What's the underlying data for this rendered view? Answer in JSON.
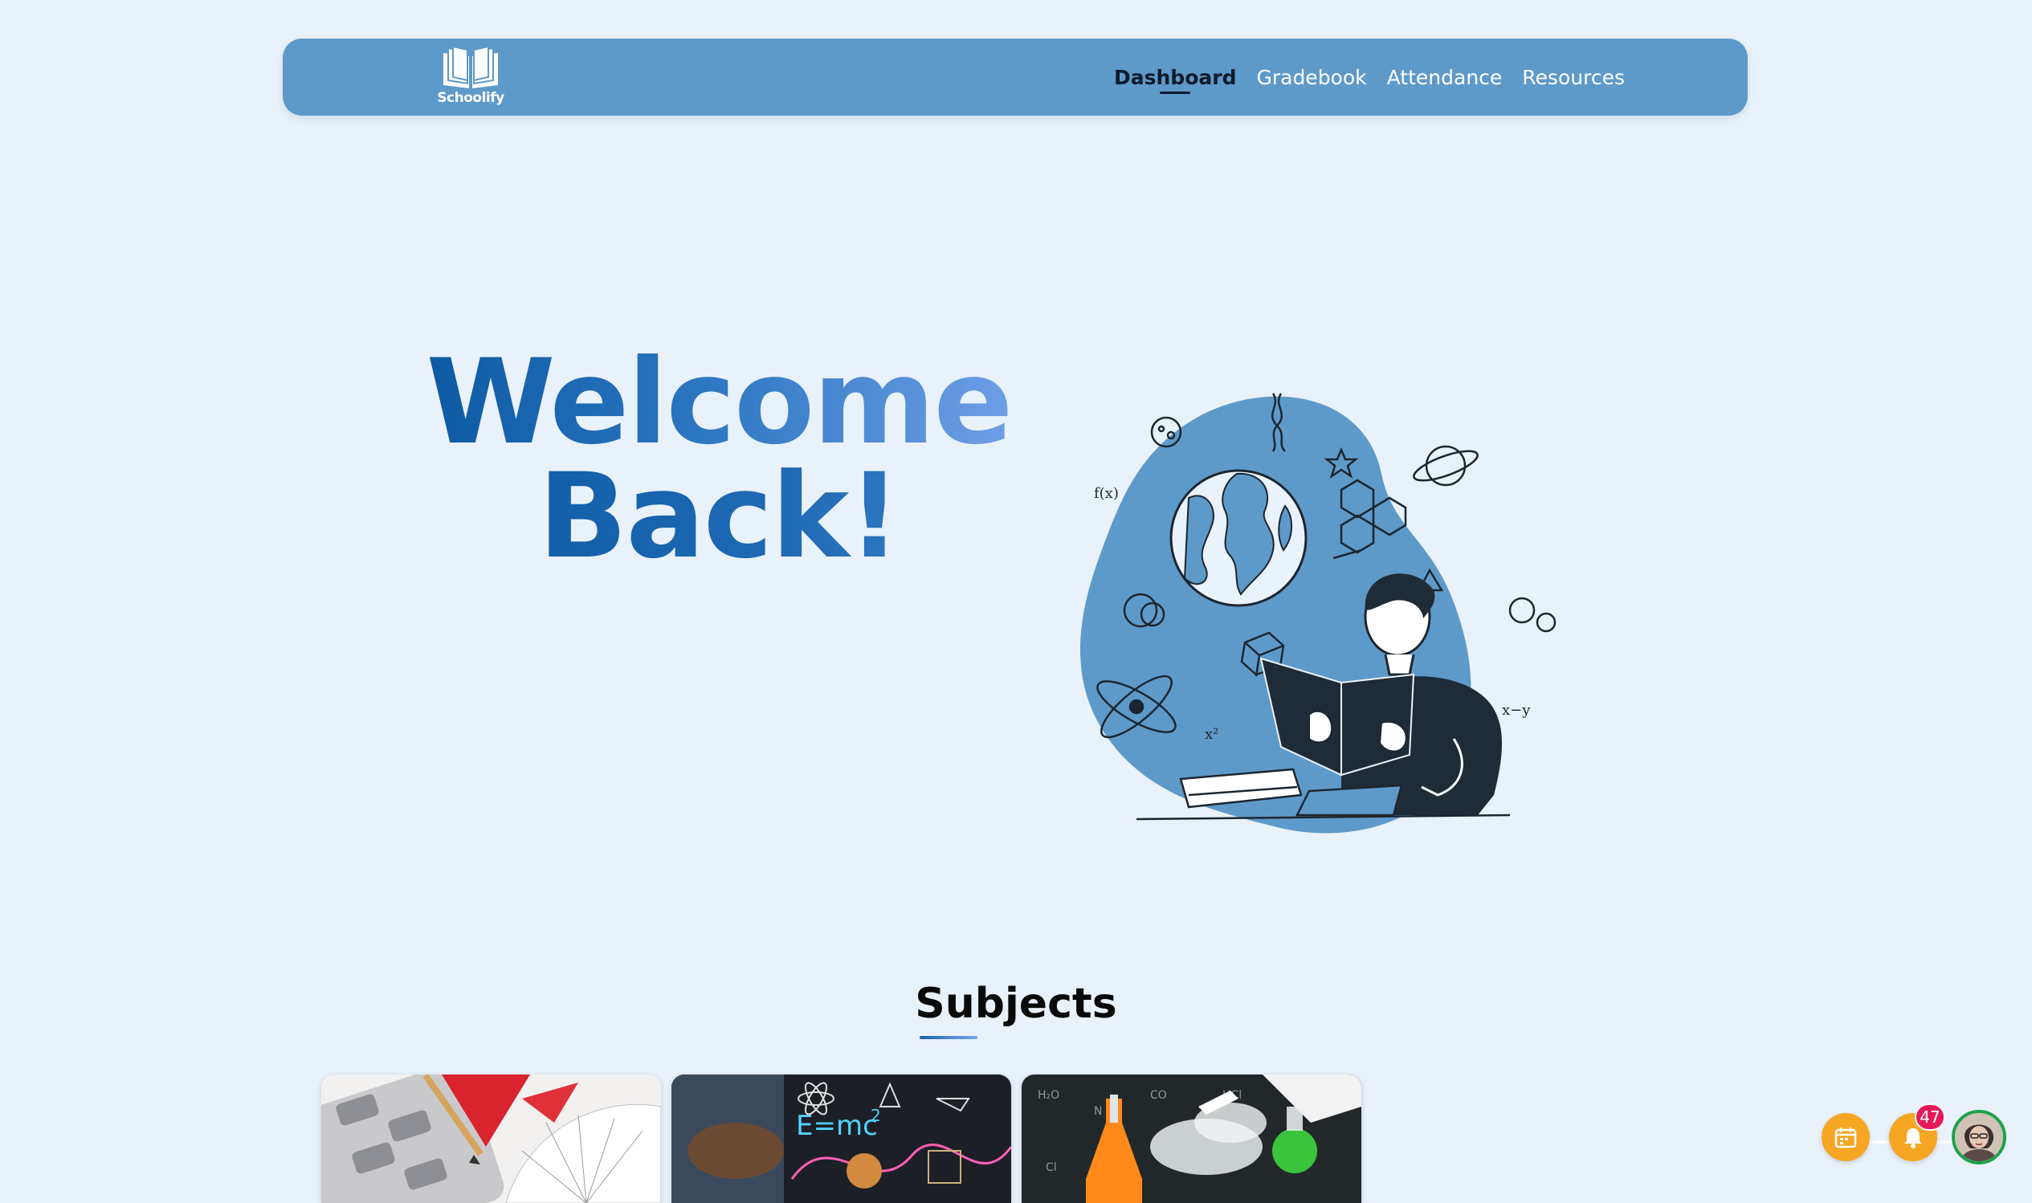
{
  "brand": {
    "name": "Schoolify",
    "logo_icon": "open-book-icon"
  },
  "nav": {
    "items": [
      {
        "label": "Dashboard",
        "active": true
      },
      {
        "label": "Gradebook",
        "active": false
      },
      {
        "label": "Attendance",
        "active": false
      },
      {
        "label": "Resources",
        "active": false
      }
    ]
  },
  "hero": {
    "title_line1": "Welcome",
    "title_line2": "Back!",
    "illustration": "student-reading-book-illustration"
  },
  "subjects": {
    "title": "Subjects",
    "cards": [
      {
        "image": "math-tools-image"
      },
      {
        "image": "physics-formulas-image"
      },
      {
        "image": "chemistry-lab-image"
      }
    ]
  },
  "actions": {
    "calendar_icon": "calendar-icon",
    "notifications_icon": "bell-icon",
    "notifications_count": "47",
    "avatar": "user-avatar"
  },
  "colors": {
    "background": "#e9f2fa",
    "navbar": "#5e9ac9",
    "accent": "#0d5aa3",
    "fab": "#f6a623",
    "badge": "#e6195a",
    "avatar_ring": "#1fa24a"
  }
}
